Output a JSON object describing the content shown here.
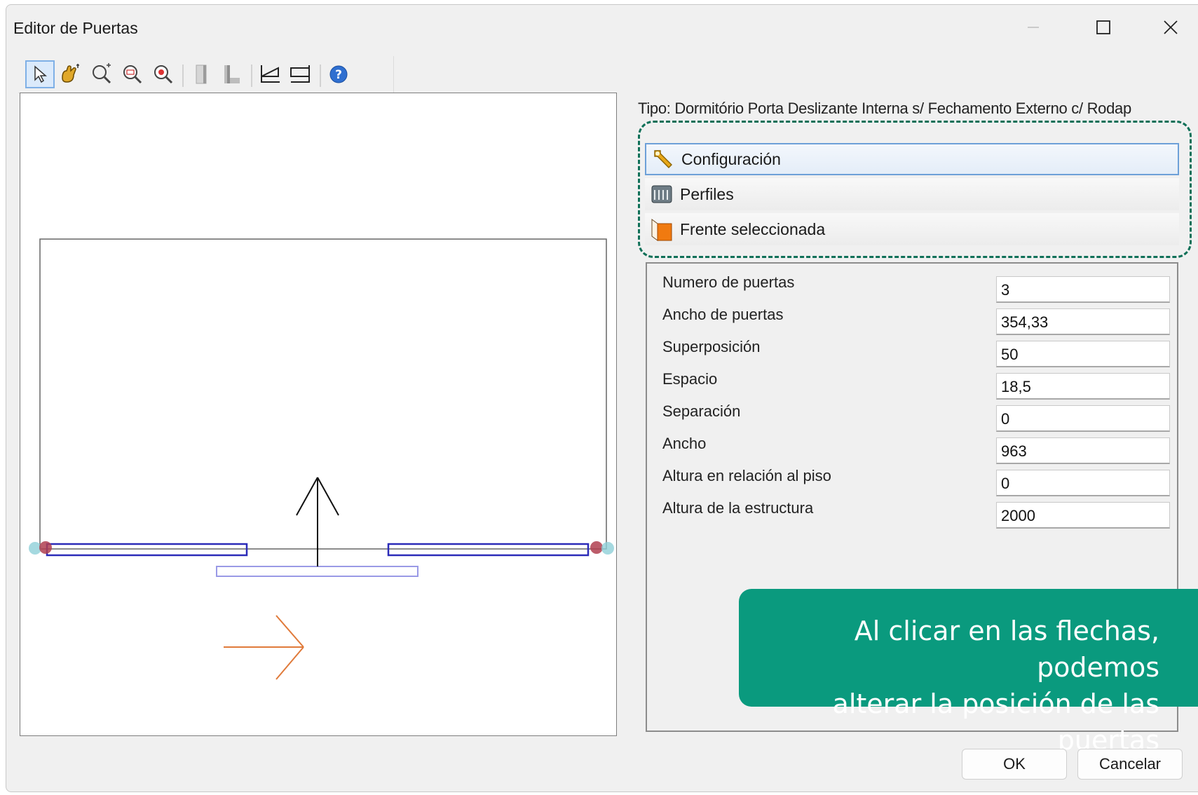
{
  "window": {
    "title": "Editor de Puertas"
  },
  "toolbar": {
    "tools": [
      "select-tool",
      "pan-tool",
      "zoom-in-tool",
      "zoom-window-tool",
      "zoom-extents-tool",
      "door-profile-tool",
      "door-profile-alt-tool",
      "open-left-tool",
      "open-right-tool",
      "help-tool"
    ],
    "active": "select-tool"
  },
  "tipo_label": "Tipo: Dormitório Porta Deslizante Interna s/ Fechamento Externo c/ Rodap",
  "menu": {
    "items": [
      {
        "label": "Configuración",
        "icon": "wrench-icon"
      },
      {
        "label": "Perfiles",
        "icon": "profiles-icon"
      },
      {
        "label": "Frente seleccionada",
        "icon": "front-panel-icon"
      }
    ],
    "selected": 0
  },
  "properties": [
    {
      "label": "Numero de puertas",
      "value": "3"
    },
    {
      "label": "Ancho de puertas",
      "value": "354,33"
    },
    {
      "label": "Superposición",
      "value": "50"
    },
    {
      "label": "Espacio",
      "value": "18,5"
    },
    {
      "label": "Separación",
      "value": "0"
    },
    {
      "label": "Ancho",
      "value": "963"
    },
    {
      "label": "Altura en relación al piso",
      "value": "0"
    },
    {
      "label": "Altura de la estructura",
      "value": "2000"
    }
  ],
  "callout": {
    "line1": "Al clicar en las flechas, podemos",
    "line2": "alterar la posición de las puertas"
  },
  "buttons": {
    "ok": "OK",
    "cancel": "Cancelar"
  },
  "colors": {
    "door_outline": "#2b2bb8",
    "door_light": "#9a9ae6",
    "arrow_orange": "#e07a3a",
    "callout_bg": "#0a9a7e",
    "dashed_frame": "#0f7058"
  }
}
